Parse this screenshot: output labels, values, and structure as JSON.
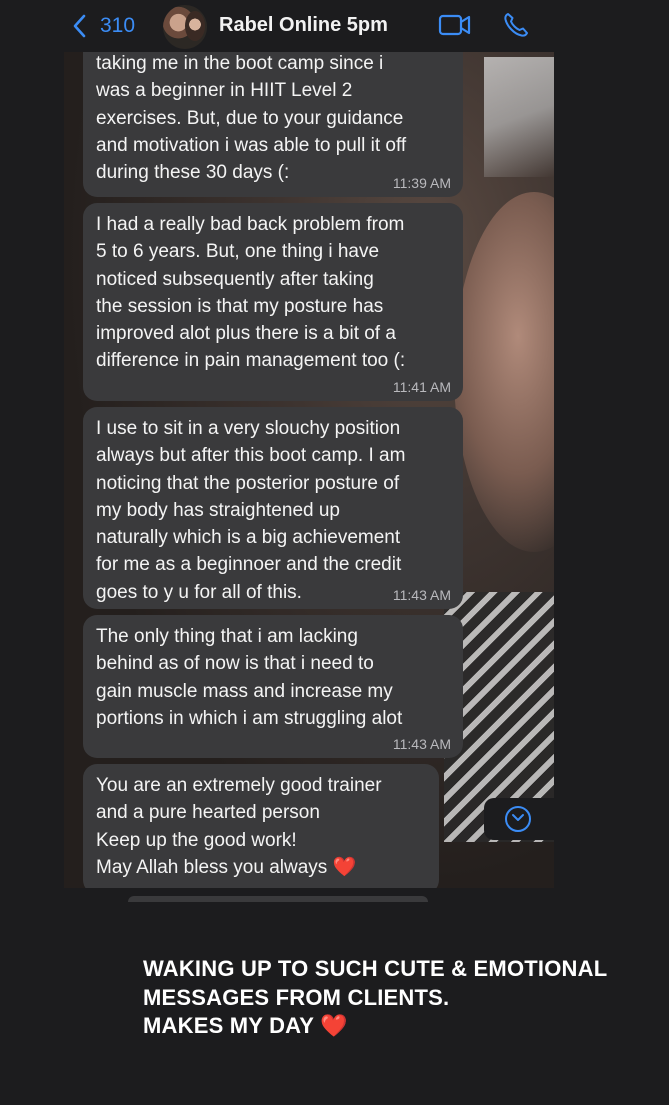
{
  "header": {
    "back_count": "310",
    "contact_name": "Rabel Online 5pm",
    "icons": [
      "chevron-left-icon",
      "avatar",
      "video-call-icon",
      "phone-icon"
    ],
    "accent_color": "#3b8cf5"
  },
  "messages": [
    {
      "text": "taking me in the boot camp since i\nwas a beginner in HIIT Level 2\nexercises. But, due to your guidance\nand motivation i was able to pull it off\nduring these 30 days (:",
      "time": "11:39 AM"
    },
    {
      "text": "I had a really bad back problem from\n5 to 6 years. But, one thing i have\nnoticed subsequently after taking\nthe session is that my posture has\nimproved alot plus there is a bit of a\ndifference in pain management too (:",
      "time": "11:41 AM"
    },
    {
      "text": "I use to sit in a very slouchy position\nalways but after this boot camp. I am\nnoticing that the posterior posture of\nmy body has straightened up\nnaturally which is a big achievement\nfor me as a beginnoer and the credit\ngoes to y u for all of this.",
      "time": "11:43 AM"
    },
    {
      "text": "The only thing that i am lacking\nbehind as of now is that i need to\ngain muscle mass and increase my\nportions in which i am struggling alot",
      "time": "11:43 AM"
    },
    {
      "text": "You are an extremely good trainer\nand a pure hearted person\nKeep up the good work!\nMay Allah bless you always",
      "heart": "❤️"
    }
  ],
  "caption": {
    "line1": "WAKING UP TO SUCH CUTE & EMOTIONAL",
    "line2": "MESSAGES FROM CLIENTS.",
    "line3": "MAKES MY DAY",
    "heart": "❤️"
  }
}
